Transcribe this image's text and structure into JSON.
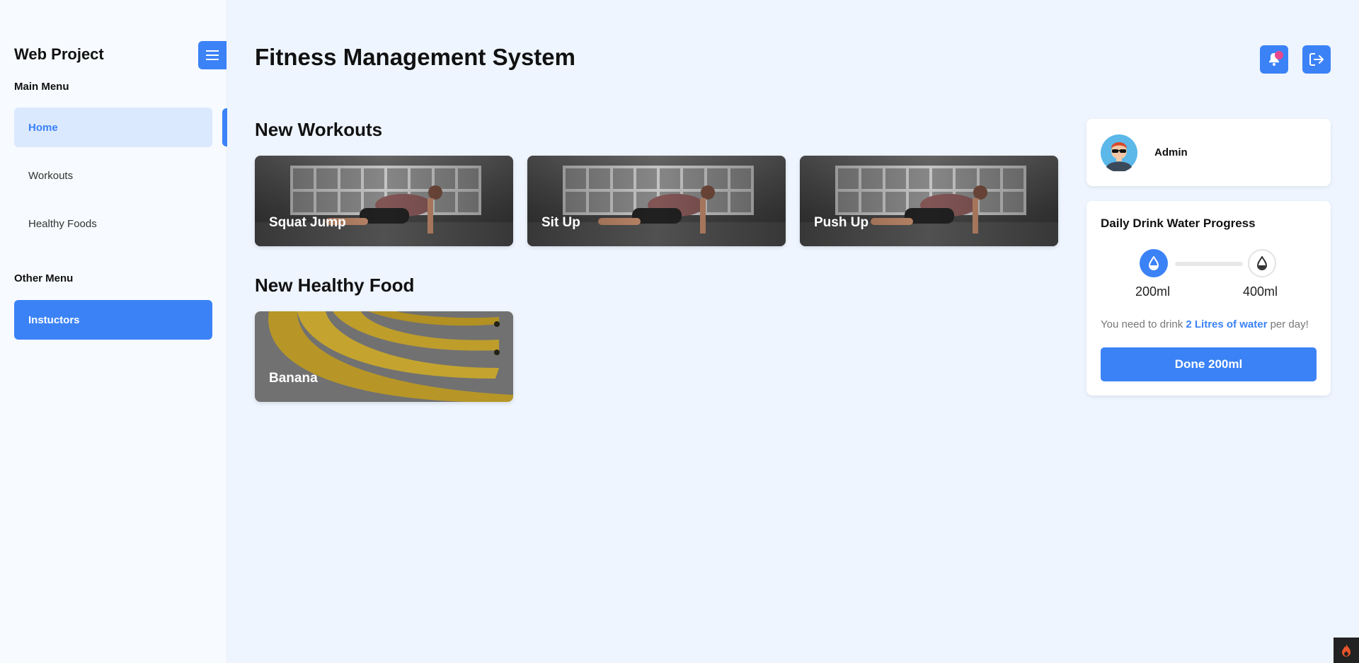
{
  "sidebar": {
    "brand": "Web Project",
    "main_menu_label": "Main Menu",
    "main_items": [
      {
        "label": "Home",
        "active": true
      },
      {
        "label": "Workouts"
      },
      {
        "label": "Healthy Foods"
      }
    ],
    "other_menu_label": "Other Menu",
    "other_items": [
      {
        "label": "Instuctors"
      }
    ]
  },
  "header": {
    "title": "Fitness Management System"
  },
  "workouts": {
    "title": "New Workouts",
    "items": [
      {
        "label": "Squat Jump"
      },
      {
        "label": "Sit Up"
      },
      {
        "label": "Push Up"
      }
    ]
  },
  "foods": {
    "title": "New Healthy Food",
    "items": [
      {
        "label": "Banana"
      }
    ]
  },
  "profile": {
    "name": "Admin"
  },
  "water": {
    "title": "Daily Drink Water Progress",
    "current": "200ml",
    "next": "400ml",
    "progress": 0,
    "note_prefix": "You need to drink ",
    "note_highlight": "2 Litres of water",
    "note_suffix": " per day!",
    "button_label": "Done 200ml"
  },
  "colors": {
    "accent": "#3b82f6",
    "notification": "#e8478d"
  }
}
